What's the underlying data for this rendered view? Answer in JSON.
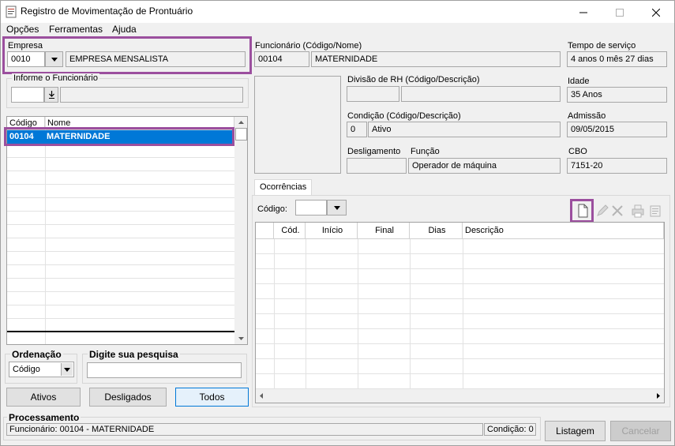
{
  "window": {
    "title": "Registro de Movimentação de Prontuário",
    "minimize_icon": "minimize-icon",
    "maximize_icon": "maximize-icon",
    "close_icon": "close-icon"
  },
  "menu": {
    "opcoes": "Opções",
    "ferramentas": "Ferramentas",
    "ajuda": "Ajuda"
  },
  "empresa": {
    "label": "Empresa",
    "codigo": "0010",
    "nome": "EMPRESA MENSALISTA"
  },
  "informe": {
    "label": "Informe o Funcionário",
    "codigo": "",
    "nome": ""
  },
  "lista_funcionarios": {
    "headers": [
      "Código",
      "Nome"
    ],
    "rows": [
      {
        "codigo": "00104",
        "nome": "MATERNIDADE",
        "selected": true
      }
    ]
  },
  "ordenacao": {
    "label": "Ordenação",
    "value": "Código"
  },
  "pesquisa": {
    "label": "Digite sua pesquisa",
    "value": ""
  },
  "filtros": {
    "ativos": "Ativos",
    "desligados": "Desligados",
    "todos": "Todos"
  },
  "funcionario": {
    "label": "Funcionário (Código/Nome)",
    "codigo": "00104",
    "nome": "MATERNIDADE"
  },
  "tempo_servico": {
    "label": "Tempo de serviço",
    "value": "4 anos 0 mês 27 dias"
  },
  "divisao_rh": {
    "label": "Divisão de RH (Código/Descrição)",
    "codigo": "",
    "descricao": ""
  },
  "idade": {
    "label": "Idade",
    "value": "35 Anos"
  },
  "condicao": {
    "label": "Condição (Código/Descrição)",
    "codigo": "0",
    "descricao": "Ativo"
  },
  "admissao": {
    "label": "Admissão",
    "value": "09/05/2015"
  },
  "desligamento": {
    "label": "Desligamento",
    "value": ""
  },
  "funcao": {
    "label": "Função",
    "value": "Operador de máquina"
  },
  "cbo": {
    "label": "CBO",
    "value": "7151-20"
  },
  "ocorrencias": {
    "tab_label": "Ocorrências",
    "codigo_label": "Código:",
    "codigo_value": "",
    "headers": [
      "Cód.",
      "Início",
      "Final",
      "Dias",
      "Descrição"
    ],
    "rows": []
  },
  "processamento": {
    "label": "Processamento",
    "status_funcionario": "Funcionário: 00104 - MATERNIDADE",
    "status_condicao": "Condição: 0"
  },
  "buttons": {
    "listagem": "Listagem",
    "cancelar": "Cancelar"
  },
  "colors": {
    "highlight": "#9b4f9e",
    "selection": "#0078d7"
  }
}
